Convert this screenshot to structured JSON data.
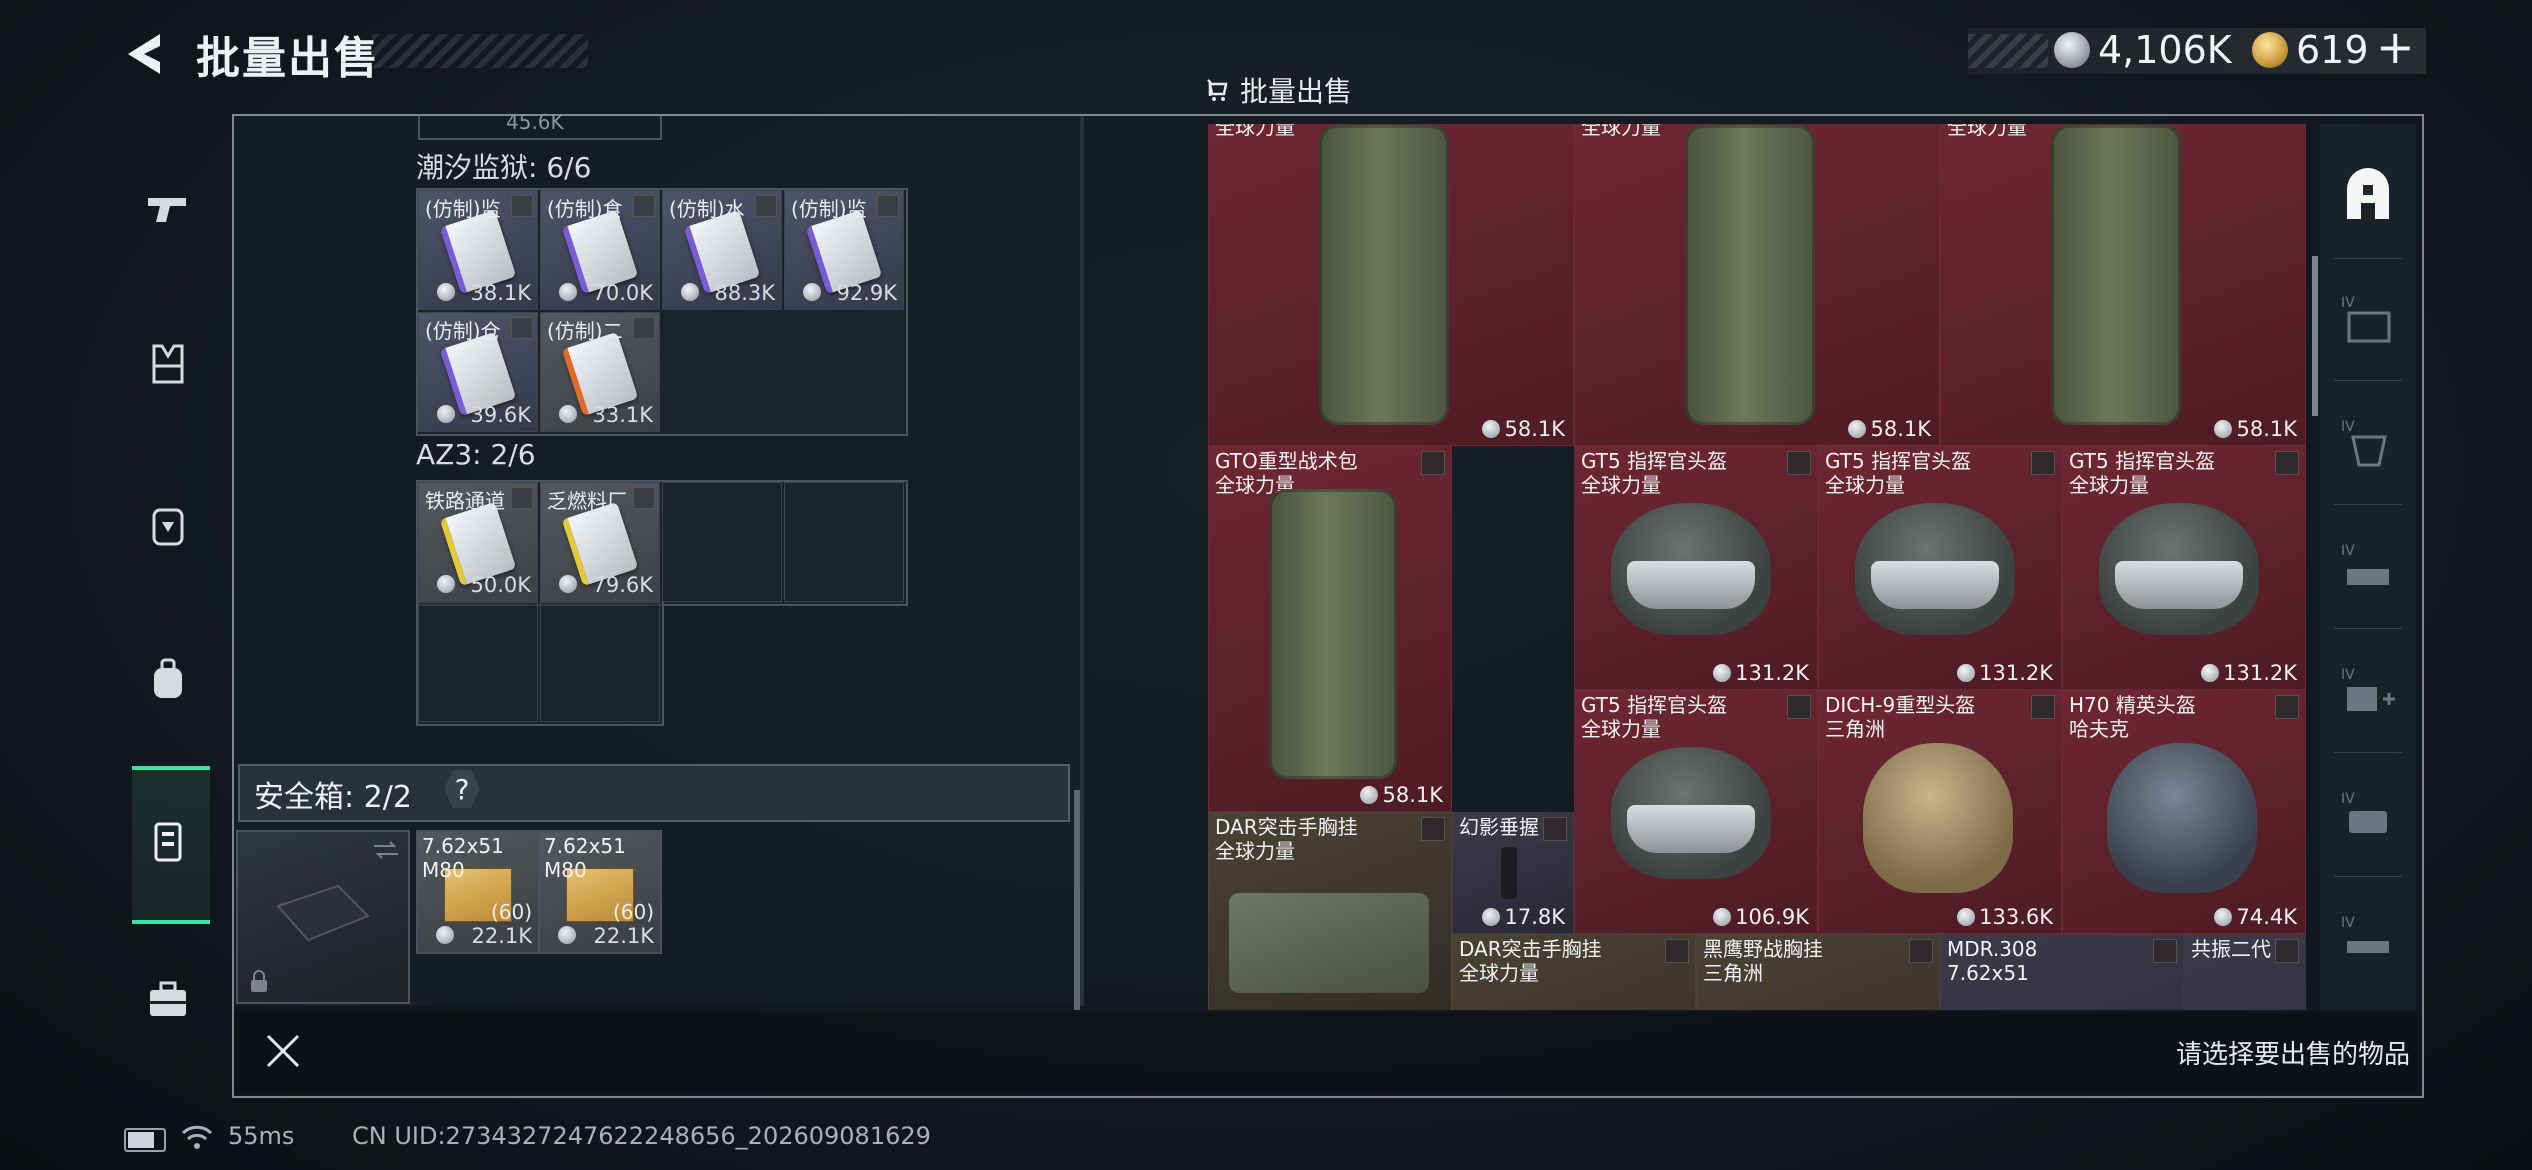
{
  "header": {
    "title": "批量出售",
    "subtitle": "批量出售",
    "currency_silver": "4,106K",
    "currency_gold": "619",
    "plus": "+"
  },
  "stash": {
    "partial_top_value": "45.6K",
    "sections": [
      {
        "label": "潮汐监狱: 6/6",
        "items": [
          {
            "name": "(仿制)监",
            "price": "38.1K",
            "accent": "purple"
          },
          {
            "name": "(仿制)食",
            "price": "70.0K",
            "accent": "purple"
          },
          {
            "name": "(仿制)水",
            "price": "88.3K",
            "accent": "purple"
          },
          {
            "name": "(仿制)监",
            "price": "92.9K",
            "accent": "purple"
          },
          {
            "name": "(仿制)仓",
            "price": "39.6K",
            "accent": "purple"
          },
          {
            "name": "(仿制)二",
            "price": "33.1K",
            "accent": "orange"
          }
        ]
      },
      {
        "label": "AZ3: 2/6",
        "items": [
          {
            "name": "铁路通道",
            "price": "50.0K",
            "accent": "yellow"
          },
          {
            "name": "乏燃料厂",
            "price": "79.6K",
            "accent": "yellow"
          }
        ]
      }
    ],
    "safe": {
      "label": "安全箱: 2/2",
      "help": "?",
      "ammo": [
        {
          "name1": "7.62x51",
          "name2": "M80",
          "count": "(60)",
          "price": "22.1K"
        },
        {
          "name1": "7.62x51",
          "name2": "M80",
          "count": "(60)",
          "price": "22.1K"
        }
      ]
    }
  },
  "sell_grid": {
    "top_row": [
      {
        "name": "全球力量",
        "price": "58.1K"
      },
      {
        "name": "全球力量",
        "price": "58.1K"
      },
      {
        "name": "全球力量",
        "price": "58.1K"
      }
    ],
    "row2": [
      {
        "name": "GTO重型战术包",
        "sub": "全球力量",
        "price": "58.1K"
      },
      {
        "name": "GT5 指挥官头盔",
        "sub": "全球力量",
        "price": "131.2K"
      },
      {
        "name": "GT5 指挥官头盔",
        "sub": "全球力量",
        "price": "131.2K"
      },
      {
        "name": "GT5 指挥官头盔",
        "sub": "全球力量",
        "price": "131.2K"
      }
    ],
    "row3": [
      {
        "name": "GT5 指挥官头盔",
        "sub": "全球力量",
        "price": "106.9K"
      },
      {
        "name": "DICH-9重型头盔",
        "sub": "三角洲",
        "price": "133.6K"
      },
      {
        "name": "H70 精英头盔",
        "sub": "哈夫克",
        "price": "74.4K"
      }
    ],
    "dar_cell": {
      "name": "DAR突击手胸挂",
      "sub": "全球力量"
    },
    "grip_cell": {
      "name": "幻影垂握",
      "price": "17.8K"
    },
    "row4": [
      {
        "name": "DAR突击手胸挂",
        "sub": "全球力量"
      },
      {
        "name": "黑鹰野战胸挂",
        "sub": "三角洲"
      },
      {
        "name": "MDR.308",
        "sub": "7.62x51"
      },
      {
        "name": "共振二代",
        "sub": ""
      }
    ]
  },
  "right_tabs": [
    "IV",
    "IV",
    "IV",
    "IV",
    "IV"
  ],
  "bottom": {
    "hint": "请选择要出售的物品"
  },
  "status": {
    "ping": "55ms",
    "uid": "CN UID:2734327247622248656_202609081629"
  }
}
